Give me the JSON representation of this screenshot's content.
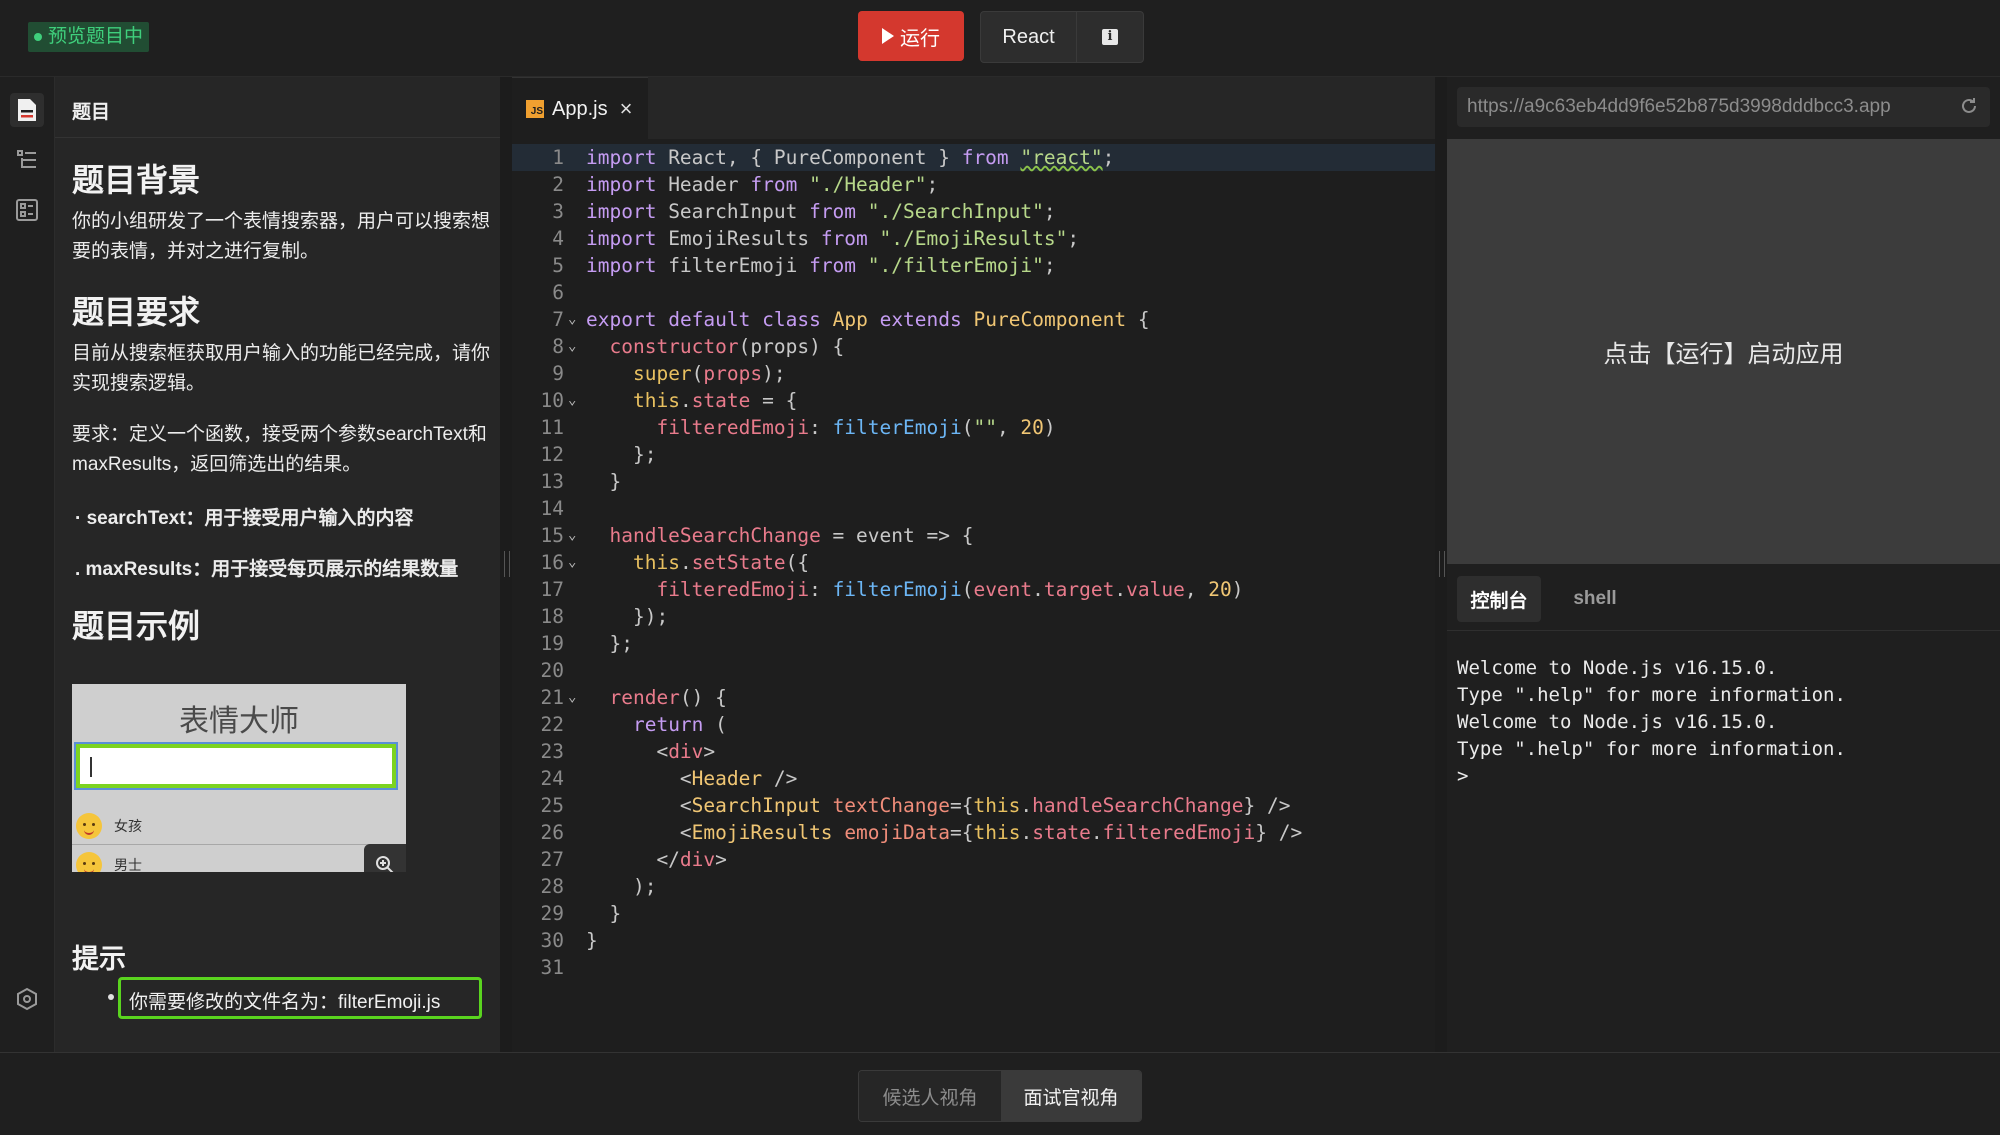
{
  "topbar": {
    "preview_badge": "预览题目中",
    "run_label": "运行",
    "framework_label": "React",
    "info_glyph": "i"
  },
  "problem": {
    "header_title": "题目",
    "background_title": "题目背景",
    "background_text": "你的小组研发了一个表情搜索器，用户可以搜索想要的表情，并对之进行复制。",
    "requirements_title": "题目要求",
    "requirements_text": "目前从搜索框获取用户输入的功能已经完成，请你实现搜索逻辑。",
    "requirements_detail": "要求：定义一个函数，接受两个参数searchText和maxResults，返回筛选出的结果。",
    "bullet_searchtext": "· searchText：用于接受用户输入的内容",
    "bullet_maxresults": ". maxResults：用于接受每页展示的结果数量",
    "example_title": "题目示例",
    "example_image": {
      "app_title": "表情大师",
      "row1_label": "女孩",
      "row2_label": "男士"
    },
    "hint_title": "提示",
    "hint_text": "你需要修改的文件名为：filterEmoji.js"
  },
  "editor": {
    "tab_filename": "App.js",
    "tab_close": "×",
    "js_badge": "JS"
  },
  "preview": {
    "url": "https://a9c63eb4dd9f6e52b875d3998dddbcc3.app",
    "hint": "点击【运行】启动应用",
    "tabs": [
      "控制台",
      "shell"
    ],
    "console_output": "Welcome to Node.js v16.15.0.\nType \".help\" for more information.\nWelcome to Node.js v16.15.0.\nType \".help\" for more information.\n>"
  },
  "bottombar": {
    "candidate_view": "候选人视角",
    "interviewer_view": "面试官视角"
  },
  "colors": {
    "run_button": "#d4382e",
    "preview_badge_text": "#3fcf7c",
    "hint_border": "#5ad41f"
  },
  "icons": [
    "document-icon",
    "outline-icon",
    "checklist-icon",
    "settings-hex-icon",
    "play-icon",
    "info-icon",
    "zoom-in-icon",
    "refresh-icon",
    "close-icon"
  ]
}
